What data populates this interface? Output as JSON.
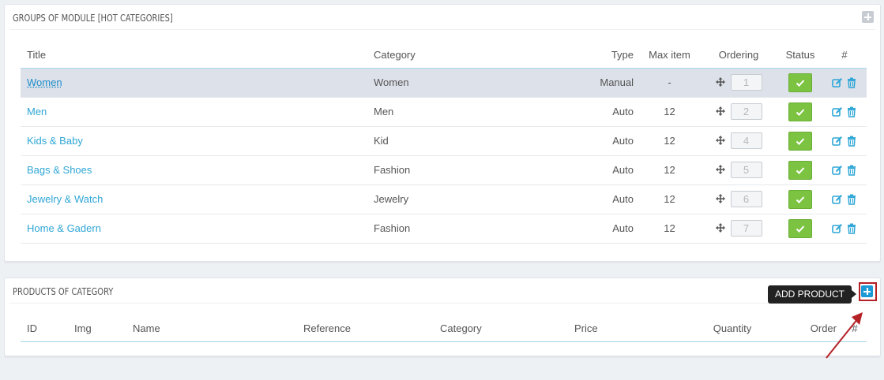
{
  "groups_panel": {
    "title": "GROUPS OF MODULE [HOT CATEGORIES]",
    "columns": [
      "Title",
      "Category",
      "Type",
      "Max item",
      "Ordering",
      "Status",
      "#"
    ],
    "rows": [
      {
        "title": "Women",
        "category": "Women",
        "type": "Manual",
        "max_item": "-",
        "ordering": "1",
        "status": "enabled"
      },
      {
        "title": "Men",
        "category": "Men",
        "type": "Auto",
        "max_item": "12",
        "ordering": "2",
        "status": "enabled"
      },
      {
        "title": "Kids & Baby",
        "category": "Kid",
        "type": "Auto",
        "max_item": "12",
        "ordering": "4",
        "status": "enabled"
      },
      {
        "title": "Bags & Shoes",
        "category": "Fashion",
        "type": "Auto",
        "max_item": "12",
        "ordering": "5",
        "status": "enabled"
      },
      {
        "title": "Jewelry & Watch",
        "category": "Jewelry",
        "type": "Auto",
        "max_item": "12",
        "ordering": "6",
        "status": "enabled"
      },
      {
        "title": "Home & Gadern",
        "category": "Fashion",
        "type": "Auto",
        "max_item": "12",
        "ordering": "7",
        "status": "enabled"
      }
    ]
  },
  "products_panel": {
    "title": "PRODUCTS OF CATEGORY",
    "add_tooltip": "ADD PRODUCT",
    "columns": [
      "ID",
      "Img",
      "Name",
      "Reference",
      "Category",
      "Price",
      "Quantity",
      "Order",
      "#"
    ]
  },
  "colors": {
    "accent": "#2ea6d6",
    "status_green": "#7cc341",
    "highlight_red": "#b42126"
  },
  "icons": {
    "move": "move-arrows-icon",
    "edit": "edit-icon",
    "delete": "trash-icon",
    "add": "plus-square-icon",
    "check": "check-icon"
  }
}
